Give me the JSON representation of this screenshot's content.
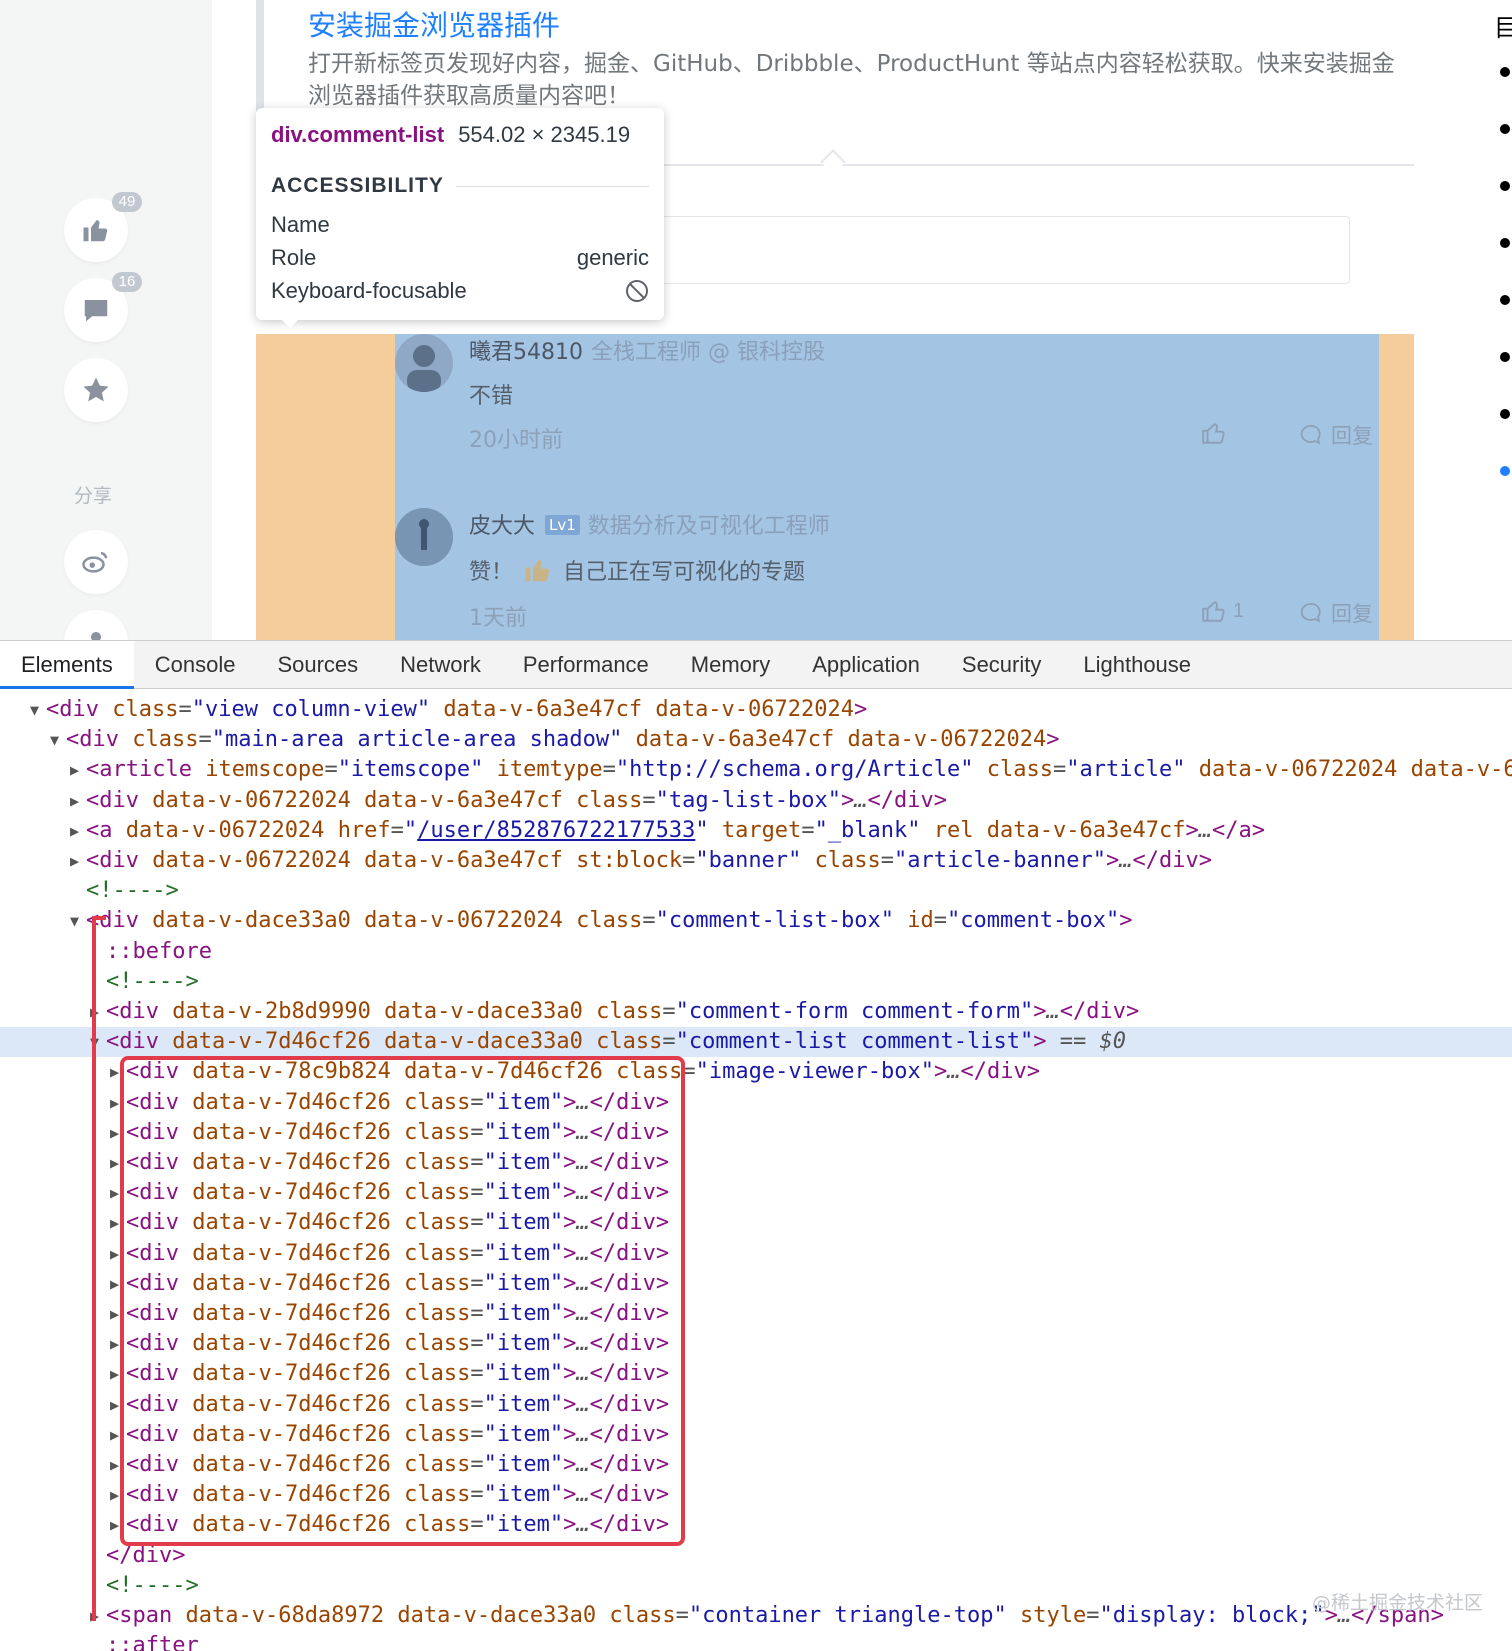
{
  "page": {
    "rail": {
      "like_count": "49",
      "comment_count": "16",
      "share_label": "分享"
    },
    "banner": {
      "title": "安装掘金浏览器插件",
      "description": "打开新标签页发现好内容，掘金、GitHub、Dribbble、ProductHunt 等站点内容轻松获取。快来安装掘金浏览器插件获取高质量内容吧！"
    },
    "toc_head": "目",
    "comments": [
      {
        "user": "曦君54810",
        "title": "全栈工程师 @ 银科控股",
        "text": "不错",
        "time": "20小时前",
        "likes": "",
        "reply": "回复"
      },
      {
        "user": "皮大大",
        "level": "Lv1",
        "title": "数据分析及可视化工程师",
        "text_before": "赞！",
        "text_after": "自己正在写可视化的专题",
        "time": "1天前",
        "likes": "1",
        "reply": "回复"
      }
    ]
  },
  "inspector": {
    "tag": "div",
    "class_selector": ".comment-list",
    "dimensions": "554.02 × 2345.19",
    "section": "ACCESSIBILITY",
    "rows": [
      {
        "label": "Name",
        "value": ""
      },
      {
        "label": "Role",
        "value": "generic"
      },
      {
        "label": "Keyboard-focusable",
        "value": ""
      }
    ]
  },
  "devtools": {
    "tabs": [
      "Elements",
      "Console",
      "Sources",
      "Network",
      "Performance",
      "Memory",
      "Application",
      "Security",
      "Lighthouse"
    ],
    "active_tab": "Elements",
    "selected_marker": "== $0",
    "item_count": 15
  },
  "watermark": "@稀土掘金技术社区",
  "colors": {
    "accent": "#1e80ff",
    "highlight_content": "#a4c4e4",
    "highlight_margin": "#f5cc9c",
    "annotation_red": "#e23b4b",
    "devtools_tab_active": "#1a73e8"
  }
}
